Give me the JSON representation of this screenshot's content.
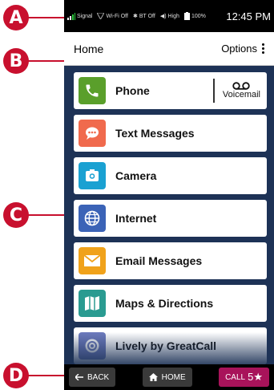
{
  "callouts": [
    "A",
    "B",
    "C",
    "D"
  ],
  "status_bar": {
    "signal": "Signal",
    "wifi": "Wi-Fi Off",
    "bt": "BT Off",
    "volume": "High",
    "battery": "100%",
    "time": "12:45 PM"
  },
  "header": {
    "title": "Home",
    "options_label": "Options"
  },
  "list": {
    "items": [
      {
        "label": "Phone",
        "icon": "phone-icon",
        "color": "#5a9f2b"
      },
      {
        "label": "Text Messages",
        "icon": "chat-bubble-icon",
        "color": "#f06a4d"
      },
      {
        "label": "Camera",
        "icon": "camera-icon",
        "color": "#1aa1d2"
      },
      {
        "label": "Internet",
        "icon": "globe-icon",
        "color": "#3b63b7"
      },
      {
        "label": "Email Messages",
        "icon": "envelope-icon",
        "color": "#f0a21b"
      },
      {
        "label": "Maps & Directions",
        "icon": "map-icon",
        "color": "#2a9b91"
      },
      {
        "label": "Lively by GreatCall",
        "icon": "lively-icon",
        "color": "#6d7bbd"
      }
    ],
    "voicemail_label": "Voicemail"
  },
  "nav": {
    "back_label": "BACK",
    "home_label": "HOME",
    "call_label": "CALL",
    "call_number": "5★"
  }
}
